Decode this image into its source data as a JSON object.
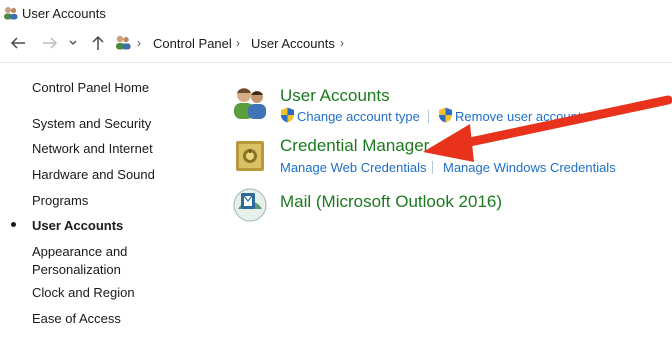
{
  "window": {
    "title": "User Accounts"
  },
  "address_bar": {
    "crumbs": [
      "Control Panel",
      "User Accounts"
    ]
  },
  "sidebar": {
    "items": [
      {
        "label": "Control Panel Home"
      },
      {
        "label": "System and Security"
      },
      {
        "label": "Network and Internet"
      },
      {
        "label": "Hardware and Sound"
      },
      {
        "label": "Programs"
      },
      {
        "label": "User Accounts",
        "current": true
      },
      {
        "label": "Appearance and Personalization"
      },
      {
        "label": "Clock and Region"
      },
      {
        "label": "Ease of Access"
      }
    ]
  },
  "main": {
    "categories": [
      {
        "title": "User Accounts",
        "icon": "users-icon",
        "links": [
          "Change account type",
          "Remove user accounts"
        ]
      },
      {
        "title": "Credential Manager",
        "icon": "vault-icon",
        "links": [
          "Manage Web Credentials",
          "Manage Windows Credentials"
        ]
      },
      {
        "title": "Mail (Microsoft Outlook 2016)",
        "icon": "mail-icon",
        "links": []
      }
    ]
  },
  "colors": {
    "category_title": "#1c7a1e",
    "link": "#1e6fc7",
    "annotation_arrow": "#e8321c"
  }
}
